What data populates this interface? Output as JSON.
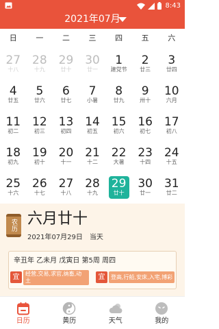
{
  "status_bar": {
    "time": "8:43",
    "left_icon": "image-icon",
    "right_icons": [
      "wifi-icon",
      "signal-icon",
      "battery-icon"
    ]
  },
  "header": {
    "title": "2021年07月",
    "dropdown_icon": "triangle-down-icon"
  },
  "weekdays": [
    "日",
    "一",
    "二",
    "三",
    "四",
    "五",
    "六"
  ],
  "calendar": {
    "weeks": [
      [
        {
          "day": 27,
          "lunar": "十八",
          "other_month": true
        },
        {
          "day": 28,
          "lunar": "十九",
          "other_month": true
        },
        {
          "day": 29,
          "lunar": "廿十",
          "other_month": true
        },
        {
          "day": 30,
          "lunar": "廿一",
          "other_month": true
        },
        {
          "day": 1,
          "lunar": "建党节"
        },
        {
          "day": 2,
          "lunar": "廿三"
        },
        {
          "day": 3,
          "lunar": "廿四"
        }
      ],
      [
        {
          "day": 4,
          "lunar": "廿五"
        },
        {
          "day": 5,
          "lunar": "廿六"
        },
        {
          "day": 6,
          "lunar": "廿七"
        },
        {
          "day": 7,
          "lunar": "小暑"
        },
        {
          "day": 8,
          "lunar": "廿九"
        },
        {
          "day": 9,
          "lunar": "卅十"
        },
        {
          "day": 10,
          "lunar": "六月"
        }
      ],
      [
        {
          "day": 11,
          "lunar": "初二"
        },
        {
          "day": 12,
          "lunar": "初三"
        },
        {
          "day": 13,
          "lunar": "初四"
        },
        {
          "day": 14,
          "lunar": "初五"
        },
        {
          "day": 15,
          "lunar": "初六"
        },
        {
          "day": 16,
          "lunar": "初七"
        },
        {
          "day": 17,
          "lunar": "初八"
        }
      ],
      [
        {
          "day": 18,
          "lunar": "初九"
        },
        {
          "day": 19,
          "lunar": "初十"
        },
        {
          "day": 20,
          "lunar": "十一"
        },
        {
          "day": 21,
          "lunar": "十二"
        },
        {
          "day": 22,
          "lunar": "大暑"
        },
        {
          "day": 23,
          "lunar": "十四"
        },
        {
          "day": 24,
          "lunar": "十五"
        }
      ],
      [
        {
          "day": 25,
          "lunar": "十六"
        },
        {
          "day": 26,
          "lunar": "十七"
        },
        {
          "day": 27,
          "lunar": "十八"
        },
        {
          "day": 28,
          "lunar": "十九"
        },
        {
          "day": 29,
          "lunar": "廿十",
          "selected": true
        },
        {
          "day": 30,
          "lunar": "廿一"
        },
        {
          "day": 31,
          "lunar": "廿二"
        }
      ]
    ]
  },
  "almanac": {
    "badge": "农历",
    "lunar_date": "六月廿十",
    "solar_date": "2021年07月29日",
    "today_label": "当天",
    "ganzhi": "辛丑年 乙未月 戊寅日 第5周 周四",
    "tags": [
      {
        "label": "宜",
        "items": "经营,交易,求官,纳畜,动土"
      },
      {
        "label": "宜",
        "items": "登高,行船,安床,入宅,博彩"
      }
    ]
  },
  "bottom_nav": [
    {
      "label": "日历",
      "icon": "calendar-icon",
      "active": true
    },
    {
      "label": "黄历",
      "icon": "yin-yang-icon",
      "active": false
    },
    {
      "label": "天气",
      "icon": "weather-cloud-icon",
      "active": false
    },
    {
      "label": "我的",
      "icon": "profile-face-icon",
      "active": false
    }
  ],
  "colors": {
    "accent": "#e9533b",
    "selected": "#1fb39b",
    "panel": "#fdf4e8",
    "tag": "#e4573a",
    "tag_band": "#f2a274"
  }
}
